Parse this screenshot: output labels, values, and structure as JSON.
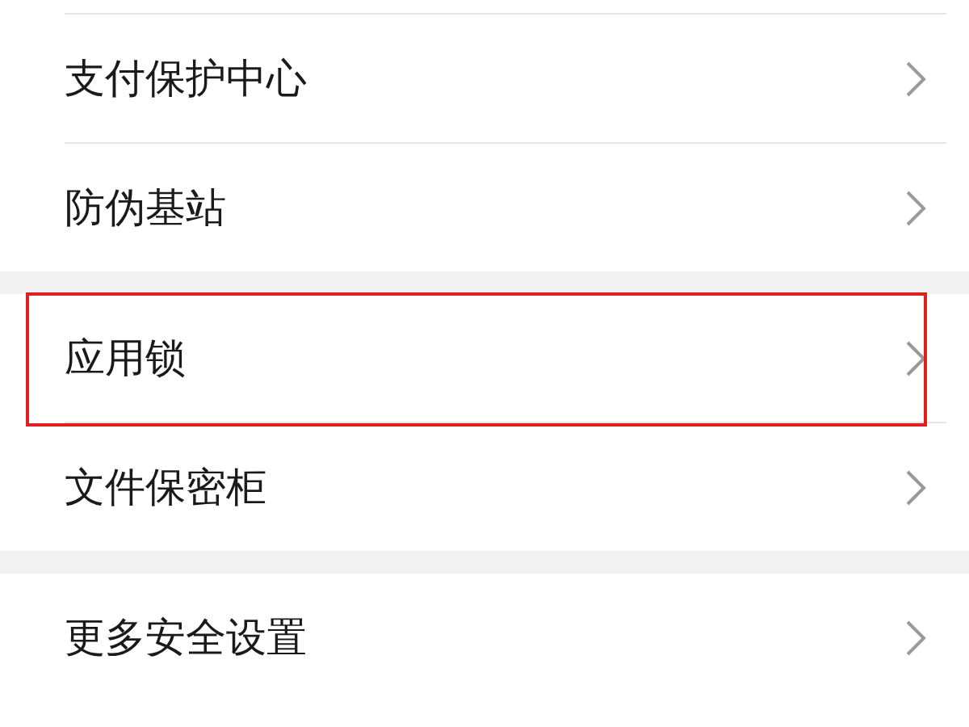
{
  "groups": [
    {
      "items": [
        {
          "label": "支付保护中心",
          "highlighted": false
        },
        {
          "label": "防伪基站",
          "highlighted": false
        }
      ]
    },
    {
      "items": [
        {
          "label": "应用锁",
          "highlighted": true
        },
        {
          "label": "文件保密柜",
          "highlighted": false
        }
      ]
    },
    {
      "items": [
        {
          "label": "更多安全设置",
          "highlighted": false
        }
      ]
    }
  ]
}
